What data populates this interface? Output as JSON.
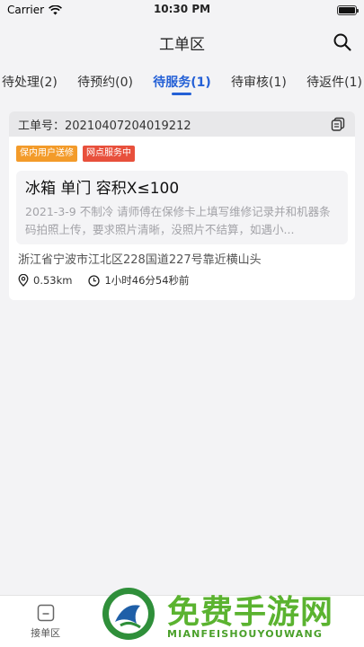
{
  "status_bar": {
    "carrier": "Carrier",
    "time": "10:30 PM"
  },
  "nav": {
    "title": "工单区"
  },
  "tabs": [
    {
      "label": "待处理(2)",
      "active": false
    },
    {
      "label": "待预约(0)",
      "active": false
    },
    {
      "label": "待服务(1)",
      "active": true
    },
    {
      "label": "待审核(1)",
      "active": false
    },
    {
      "label": "待返件(1)",
      "active": false
    }
  ],
  "order": {
    "number_label": "工单号：20210407204019212",
    "badges": [
      {
        "label": "保内用户送修",
        "color": "#f39b2a"
      },
      {
        "label": "网点服务中",
        "color": "#e8503c"
      }
    ],
    "product": "冰箱  单门 容积X≤100",
    "description": "2021-3-9 不制冷 请师傅在保修卡上填写维修记录并和机器条码拍照上传，要求照片清晰，没照片不结算，如遇小...",
    "address": "浙江省宁波市江北区228国道227号靠近横山头",
    "distance": "0.53km",
    "elapsed": "1小时46分54秒前"
  },
  "bottom_nav": {
    "items": [
      {
        "label": "接单区",
        "icon": "inbox-icon"
      }
    ]
  },
  "watermark": {
    "title": "免费手游网",
    "subtitle": "MIANFEISHOUYOUWANG"
  },
  "colors": {
    "accent": "#2460d6",
    "badge_orange": "#f39b2a",
    "badge_red": "#e8503c",
    "watermark_green": "#5bb330"
  }
}
